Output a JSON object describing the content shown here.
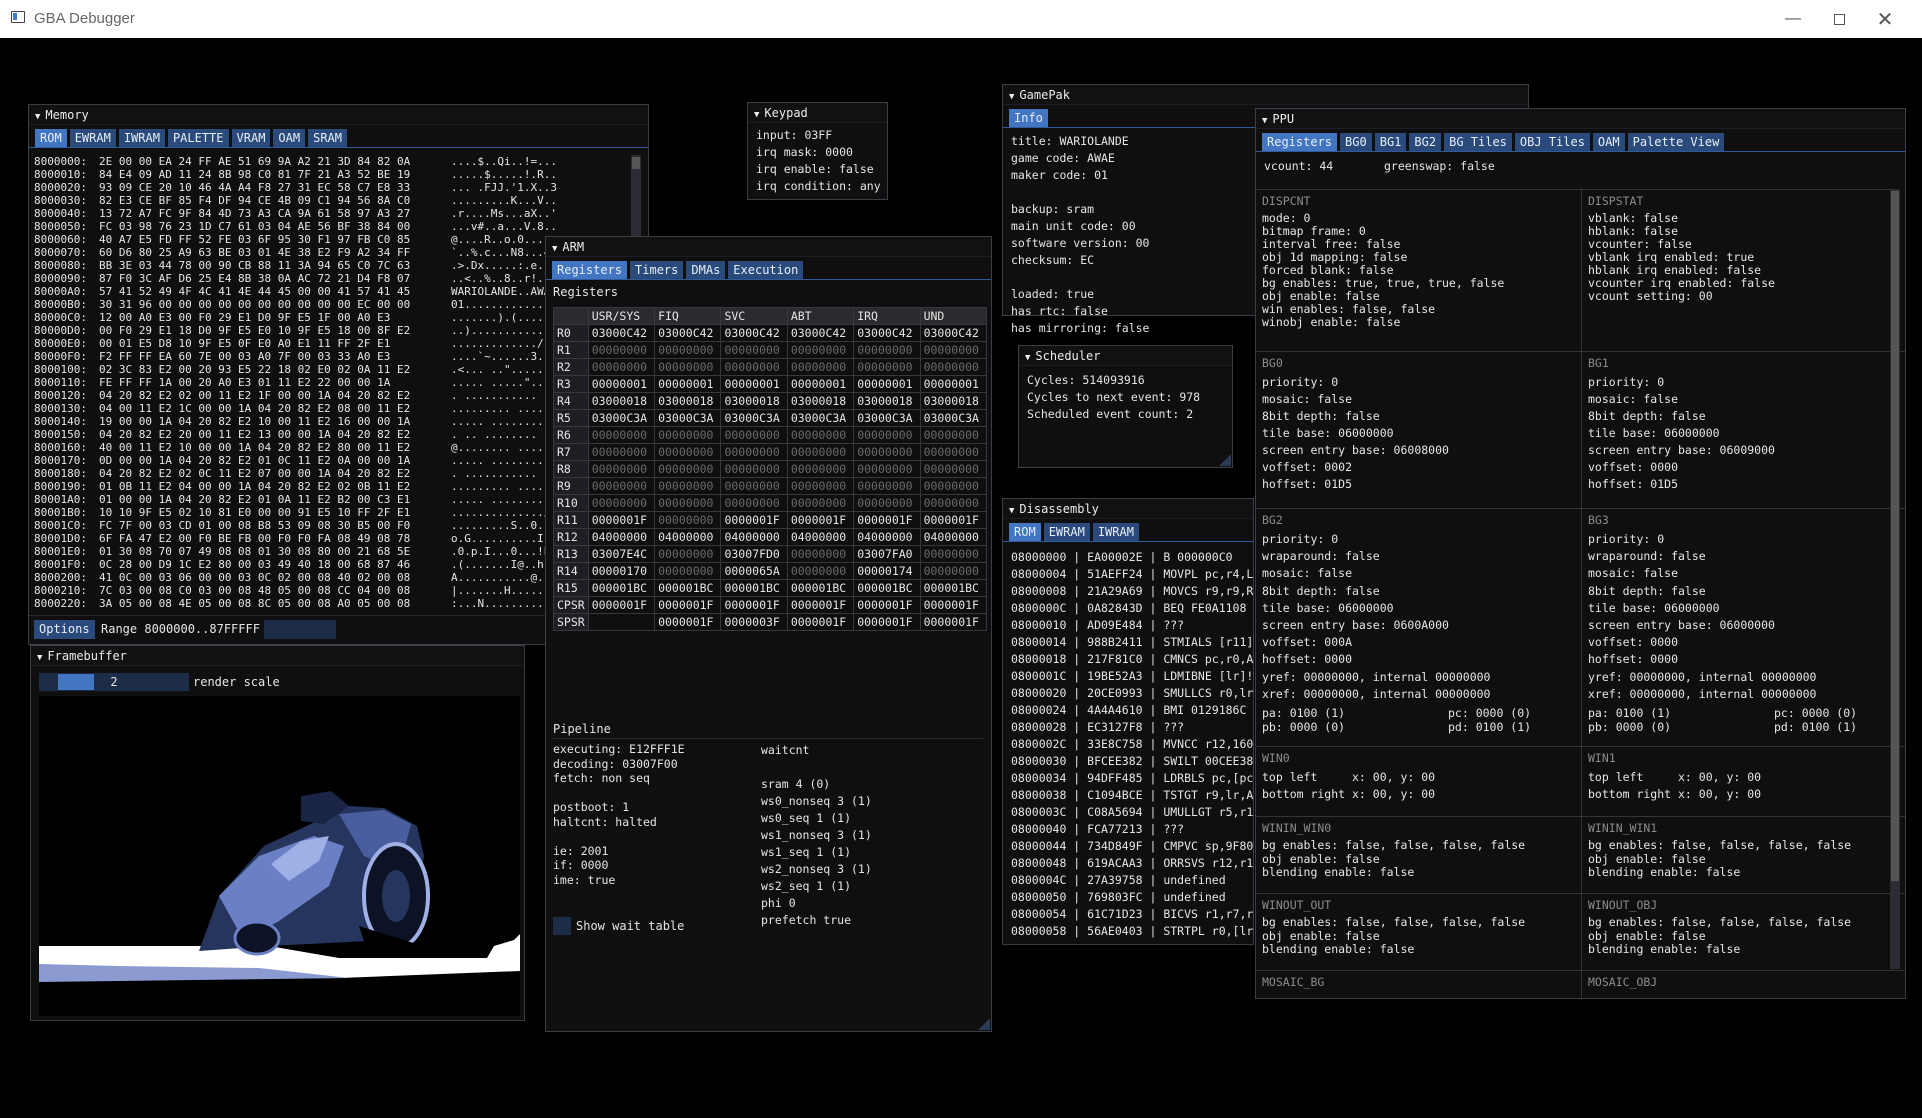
{
  "window": {
    "title": "GBA Debugger"
  },
  "memory": {
    "title": "Memory",
    "tabs": [
      "ROM",
      "EWRAM",
      "IWRAM",
      "PALETTE",
      "VRAM",
      "OAM",
      "SRAM"
    ],
    "rows": [
      {
        "addr": "8000000:",
        "hex": "2E 00 00 EA 24 FF AE 51 69 9A A2 21 3D 84 82 0A",
        "ascii": "....$..Qi..!=..."
      },
      {
        "addr": "8000010:",
        "hex": "84 E4 09 AD 11 24 8B 98 C0 81 7F 21 A3 52 BE 19",
        "ascii": ".....$.....!.R.."
      },
      {
        "addr": "8000020:",
        "hex": "93 09 CE 20 10 46 4A A4 F8 27 31 EC 58 C7 E8 33",
        "ascii": "... .FJJ.'1.X..3"
      },
      {
        "addr": "8000030:",
        "hex": "82 E3 CE BF 85 F4 DF 94 CE 4B 09 C1 94 56 8A C0",
        "ascii": ".........K...V.."
      },
      {
        "addr": "8000040:",
        "hex": "13 72 A7 FC 9F 84 4D 73 A3 CA 9A 61 58 97 A3 27",
        "ascii": ".r....Ms...aX..'"
      },
      {
        "addr": "8000050:",
        "hex": "FC 03 98 76 23 1D C7 61 03 04 AE 56 BF 38 84 00",
        "ascii": "...v#..a...V.8.."
      },
      {
        "addr": "8000060:",
        "hex": "40 A7 E5 FD FF 52 FE 03 6F 95 30 F1 97 FB C0 85",
        "ascii": "@....R..o.0....."
      },
      {
        "addr": "8000070:",
        "hex": "60 D6 80 25 A9 63 BE 03 01 4E 38 E2 F9 A2 34 FF",
        "ascii": "`..%.c...N8...4."
      },
      {
        "addr": "8000080:",
        "hex": "BB 3E 03 44 78 00 90 CB 88 11 3A 94 65 C0 7C 63",
        "ascii": ".>.Dx.....:.e.|c"
      },
      {
        "addr": "8000090:",
        "hex": "87 F0 3C AF D6 25 E4 8B 38 0A AC 72 21 D4 F8 07",
        "ascii": "..<..%..8..r!..."
      },
      {
        "addr": "80000A0:",
        "hex": "57 41 52 49 4F 4C 41 4E 44 45 00 00 41 57 41 45",
        "ascii": "WARIOLANDE..AWAE"
      },
      {
        "addr": "80000B0:",
        "hex": "30 31 96 00 00 00 00 00 00 00 00 00 00 EC 00 00",
        "ascii": "01.............."
      },
      {
        "addr": "80000C0:",
        "hex": "12 00 A0 E3 00 F0 29 E1 D0 9F E5 1F 00 A0 E3",
        "ascii": ".......).(......"
      },
      {
        "addr": "80000D0:",
        "hex": "00 F0 29 E1 18 D0 9F E5 E0 10 9F E5 18 00 8F E2",
        "ascii": "..)............."
      },
      {
        "addr": "80000E0:",
        "hex": "00 01 E5 D8 10 9F E5 0F E0 A0 E1 11 FF 2F E1",
        "ascii": "............./.."
      },
      {
        "addr": "80000F0:",
        "hex": "F2 FF FF EA 60 7E 00 03 A0 7F 00 03 33 A0 E3",
        "ascii": "....`~......3..."
      },
      {
        "addr": "8000100:",
        "hex": "02 3C 83 E2 00 20 93 E5 22 18 02 E0 02 0A 11 E2",
        "ascii": ".<... ..\"......."
      },
      {
        "addr": "8000110:",
        "hex": "FE FF FF 1A 00 20 A0 E3 01 11 E2 22 00 00 1A",
        "ascii": "..... .....\"...."
      },
      {
        "addr": "8000120:",
        "hex": "04 20 82 E2 02 00 11 E2 1F 00 00 1A 04 20 82 E2",
        "ascii": ". ........... .."
      },
      {
        "addr": "8000130:",
        "hex": "04 00 11 E2 1C 00 00 1A 04 20 82 E2 08 00 11 E2",
        "ascii": "......... ......"
      },
      {
        "addr": "8000140:",
        "hex": "19 00 00 1A 04 20 82 E2 10 00 11 E2 16 00 00 1A",
        "ascii": "..... .........."
      },
      {
        "addr": "8000150:",
        "hex": "04 20 82 E2 20 00 11 E2 13 00 00 1A 04 20 82 E2",
        "ascii": ". .. ........ .."
      },
      {
        "addr": "8000160:",
        "hex": "40 00 11 E2 10 00 00 1A 04 20 82 E2 80 00 11 E2",
        "ascii": "@........ ......"
      },
      {
        "addr": "8000170:",
        "hex": "0D 00 00 1A 04 20 82 E2 01 0C 11 E2 0A 00 00 1A",
        "ascii": "..... .........."
      },
      {
        "addr": "8000180:",
        "hex": "04 20 82 E2 02 0C 11 E2 07 00 00 1A 04 20 82 E2",
        "ascii": ". ........... .."
      },
      {
        "addr": "8000190:",
        "hex": "01 0B 11 E2 04 00 00 1A 04 20 82 E2 02 0B 11 E2",
        "ascii": "......... ......"
      },
      {
        "addr": "80001A0:",
        "hex": "01 00 00 1A 04 20 82 E2 01 0A 11 E2 B2 00 C3 E1",
        "ascii": "..... .........."
      },
      {
        "addr": "80001B0:",
        "hex": "10 10 9F E5 02 10 81 E0 00 00 91 E5 10 FF 2F E1",
        "ascii": "............../."
      },
      {
        "addr": "80001C0:",
        "hex": "FC 7F 00 03 CD 01 00 08 B8 53 09 08 30 B5 00 F0",
        "ascii": ".........S..0..."
      },
      {
        "addr": "80001D0:",
        "hex": "6F FA 47 E2 00 F0 BE FB 00 F0 F0 FA 08 49 08 78",
        "ascii": "o.G..........I.x"
      },
      {
        "addr": "80001E0:",
        "hex": "01 30 08 70 07 49 08 08 01 30 08 80 00 21 68 5E",
        "ascii": ".0.p.I...0...!h^"
      },
      {
        "addr": "80001F0:",
        "hex": "0C 28 00 D9 1C E2 80 00 03 49 40 18 00 68 87 46",
        "ascii": ".(.......I@..h.F"
      },
      {
        "addr": "8000200:",
        "hex": "41 0C 00 03 06 00 00 03 0C 02 00 08 40 02 00 08",
        "ascii": "A...........@..."
      },
      {
        "addr": "8000210:",
        "hex": "7C 03 00 08 C0 03 00 08 48 05 00 08 CC 04 00 08",
        "ascii": "|.......H......."
      },
      {
        "addr": "8000220:",
        "hex": "3A 05 00 08 4E 05 00 08 8C 05 00 08 A0 05 00 08",
        "ascii": ":...N..........."
      }
    ],
    "options_label": "Options",
    "range_label": "Range 8000000..87FFFFF",
    "range_value": ""
  },
  "keypad": {
    "title": "Keypad",
    "lines": [
      "input: 03FF",
      "irq mask: 0000",
      "irq enable: false",
      "irq condition: any"
    ]
  },
  "framebuffer": {
    "title": "Framebuffer",
    "scale_value": "2",
    "scale_label": "render scale",
    "scale_fraction": 0.5
  },
  "arm": {
    "title": "ARM",
    "tabs": [
      "Registers",
      "Timers",
      "DMAs",
      "Execution"
    ],
    "section_label": "Registers",
    "columns": [
      "",
      "USR/SYS",
      "FIQ",
      "SVC",
      "ABT",
      "IRQ",
      "UND"
    ],
    "rows": [
      {
        "name": "R0",
        "vals": [
          "03000C42",
          "03000C42",
          "03000C42",
          "03000C42",
          "03000C42",
          "03000C42"
        ]
      },
      {
        "name": "R1",
        "vals": [
          "00000000",
          "00000000",
          "00000000",
          "00000000",
          "00000000",
          "00000000"
        ]
      },
      {
        "name": "R2",
        "vals": [
          "00000000",
          "00000000",
          "00000000",
          "00000000",
          "00000000",
          "00000000"
        ]
      },
      {
        "name": "R3",
        "vals": [
          "00000001",
          "00000001",
          "00000001",
          "00000001",
          "00000001",
          "00000001"
        ]
      },
      {
        "name": "R4",
        "vals": [
          "03000018",
          "03000018",
          "03000018",
          "03000018",
          "03000018",
          "03000018"
        ]
      },
      {
        "name": "R5",
        "vals": [
          "03000C3A",
          "03000C3A",
          "03000C3A",
          "03000C3A",
          "03000C3A",
          "03000C3A"
        ]
      },
      {
        "name": "R6",
        "vals": [
          "00000000",
          "00000000",
          "00000000",
          "00000000",
          "00000000",
          "00000000"
        ]
      },
      {
        "name": "R7",
        "vals": [
          "00000000",
          "00000000",
          "00000000",
          "00000000",
          "00000000",
          "00000000"
        ]
      },
      {
        "name": "R8",
        "vals": [
          "00000000",
          "00000000",
          "00000000",
          "00000000",
          "00000000",
          "00000000"
        ]
      },
      {
        "name": "R9",
        "vals": [
          "00000000",
          "00000000",
          "00000000",
          "00000000",
          "00000000",
          "00000000"
        ]
      },
      {
        "name": "R10",
        "vals": [
          "00000000",
          "00000000",
          "00000000",
          "00000000",
          "00000000",
          "00000000"
        ]
      },
      {
        "name": "R11",
        "vals": [
          "0000001F",
          "00000000",
          "0000001F",
          "0000001F",
          "0000001F",
          "0000001F"
        ]
      },
      {
        "name": "R12",
        "vals": [
          "04000000",
          "04000000",
          "04000000",
          "04000000",
          "04000000",
          "04000000"
        ]
      },
      {
        "name": "R13",
        "vals": [
          "03007E4C",
          "00000000",
          "03007FD0",
          "00000000",
          "03007FA0",
          "00000000"
        ]
      },
      {
        "name": "R14",
        "vals": [
          "00000170",
          "00000000",
          "0000065A",
          "00000000",
          "00000174",
          "00000000"
        ]
      },
      {
        "name": "R15",
        "vals": [
          "000001BC",
          "000001BC",
          "000001BC",
          "000001BC",
          "000001BC",
          "000001BC"
        ]
      },
      {
        "name": "CPSR",
        "vals": [
          "0000001F",
          "0000001F",
          "0000001F",
          "0000001F",
          "0000001F",
          "0000001F"
        ]
      },
      {
        "name": "SPSR",
        "vals": [
          "",
          "0000001F",
          "0000003F",
          "0000001F",
          "0000001F",
          "0000001F"
        ]
      }
    ],
    "pipeline_label": "Pipeline",
    "pipeline_left": [
      "executing: E12FFF1E",
      "decoding: 03007F00",
      "fetch: non seq",
      "",
      "postboot: 1",
      "haltcnt: halted",
      "",
      "ie: 2001",
      "if: 0000",
      "ime: true"
    ],
    "waitcnt": [
      "waitcnt",
      "",
      "sram 4 (0)",
      "ws0_nonseq 3 (1)",
      "ws0_seq 1 (1)",
      "ws1_nonseq 3 (1)",
      "ws1_seq 1 (1)",
      "ws2_nonseq 3 (1)",
      "ws2_seq 1 (1)",
      "phi 0",
      "prefetch true"
    ],
    "show_wait_table": "Show wait table"
  },
  "gamepak": {
    "title": "GamePak",
    "tab": "Info",
    "lines": [
      "title: WARIOLANDE",
      "game code: AWAE",
      "maker code: 01",
      "",
      "backup: sram",
      "main unit code: 00",
      "software version: 00",
      "checksum: EC",
      "",
      "loaded: true",
      "has rtc: false",
      "has mirroring: false"
    ]
  },
  "scheduler": {
    "title": "Scheduler",
    "lines": [
      "Cycles: 514093916",
      "Cycles to next event: 978",
      "Scheduled event count: 2"
    ]
  },
  "disassembly": {
    "title": "Disassembly",
    "tabs": [
      "ROM",
      "EWRAM",
      "IWRAM"
    ],
    "lines": [
      "08000000 | EA00002E | B 000000C0",
      "08000004 | 51AEFF24 | MOVPL pc,r4,L",
      "08000008 | 21A29A69 | MOVCS r9,r9,R",
      "0800000C | 0A82843D | BEQ FE0A1108",
      "08000010 | AD09E484 | ???",
      "08000014 | 988B2411 | STMIALS [r11]",
      "08000018 | 217F81C0 | CMNCS pc,r0,A",
      "0800001C | 19BE52A3 | LDMIBNE [lr]!",
      "08000020 | 20CE0993 | SMULLCS r0,lr",
      "08000024 | 4A4A4610 | BMI 0129186C",
      "08000028 | EC3127F8 | ???",
      "0800002C | 33E8C758 | MVNCC r12,160",
      "08000030 | BFCEE382 | SWILT 00CEE38",
      "08000034 | 94DFF485 | LDRBLS pc,[pc",
      "08000038 | C1094BCE | TSTGT r9,lr,A",
      "0800003C | C08A5694 | UMULLGT r5,r1",
      "08000040 | FCA77213 | ???",
      "08000044 | 734D849F | CMPVC sp,9F80",
      "08000048 | 619ACAA3 | ORRSVS r12,r1",
      "0800004C | 27A39758 | undefined",
      "08000050 | 769803FC | undefined",
      "08000054 | 61C71D23 | BICVS r1,r7,r",
      "08000058 | 56AE0403 | STRTPL r0,[lr"
    ]
  },
  "ppu": {
    "title": "PPU",
    "tabs": [
      "Registers",
      "BG0",
      "BG1",
      "BG2",
      "BG Tiles",
      "OBJ Tiles",
      "OAM",
      "Palette View"
    ],
    "vcount": "vcount: 44",
    "greenswap": "greenswap: false",
    "dispcnt": {
      "head": "DISPCNT",
      "lines": [
        "mode: 0",
        "bitmap frame: 0",
        "interval free: false",
        "obj 1d mapping: false",
        "forced blank: false",
        "bg enables: true, true, true, false",
        "obj enable: false",
        "win enables: false, false",
        "winobj enable: false"
      ]
    },
    "dispstat": {
      "head": "DISPSTAT",
      "lines": [
        "vblank: false",
        "hblank: false",
        "vcounter: false",
        "vblank irq enabled: true",
        "hblank irq enabled: false",
        "vcounter irq enabled: false",
        "vcount setting: 00"
      ]
    },
    "bg0": {
      "head": "BG0",
      "lines": [
        "priority: 0",
        "mosaic: false",
        "8bit depth: false",
        "tile base: 06000000",
        "screen entry base: 06008000",
        "voffset: 0002",
        "hoffset: 01D5"
      ]
    },
    "bg1": {
      "head": "BG1",
      "lines": [
        "priority: 0",
        "mosaic: false",
        "8bit depth: false",
        "tile base: 06000000",
        "screen entry base: 06009000",
        "voffset: 0000",
        "hoffset: 01D5"
      ]
    },
    "bg2": {
      "head": "BG2",
      "lines": [
        "priority: 0",
        "wraparound: false",
        "mosaic: false",
        "8bit depth: false",
        "tile base: 06000000",
        "screen entry base: 0600A000",
        "voffset: 000A",
        "hoffset: 0000",
        "yref: 00000000, internal 00000000",
        "xref: 00000000, internal 00000000"
      ],
      "pa": "pa: 0100 (1)",
      "pb": "pb: 0000 (0)",
      "pc": "pc: 0000 (0)",
      "pd": "pd: 0100 (1)"
    },
    "bg3": {
      "head": "BG3",
      "lines": [
        "priority: 0",
        "wraparound: false",
        "mosaic: false",
        "8bit depth: false",
        "tile base: 06000000",
        "screen entry base: 06000000",
        "voffset: 0000",
        "hoffset: 0000",
        "yref: 00000000, internal 00000000",
        "xref: 00000000, internal 00000000"
      ],
      "pa": "pa: 0100 (1)",
      "pb": "pb: 0000 (0)",
      "pc": "pc: 0000 (0)",
      "pd": "pd: 0100 (1)"
    },
    "win0": {
      "head": "WIN0",
      "lines": [
        "top left     x: 00, y: 00",
        "bottom right x: 00, y: 00"
      ]
    },
    "win1": {
      "head": "WIN1",
      "lines": [
        "top left     x: 00, y: 00",
        "bottom right x: 00, y: 00"
      ]
    },
    "winin0": {
      "head": "WININ_WIN0",
      "lines": [
        "bg enables: false, false, false, false",
        "obj enable: false",
        "blending enable: false"
      ]
    },
    "winin1": {
      "head": "WININ_WIN1",
      "lines": [
        "bg enables: false, false, false, false",
        "obj enable: false",
        "blending enable: false"
      ]
    },
    "winout": {
      "head": "WINOUT_OUT",
      "lines": [
        "bg enables: false, false, false, false",
        "obj enable: false",
        "blending enable: false"
      ]
    },
    "winobj": {
      "head": "WINOUT_OBJ",
      "lines": [
        "bg enables: false, false, false, false",
        "obj enable: false",
        "blending enable: false"
      ]
    },
    "mosaic_bg": "MOSAIC_BG",
    "mosaic_obj": "MOSAIC_OBJ"
  },
  "icons": {
    "window": "app-window-icon",
    "collapse": "collapse-triangle-icon"
  },
  "colors": {
    "tab_active": "#4276c2",
    "tab": "#294a7a",
    "window_bg": "#0f0f0f",
    "screen_blue": "#6b7fc4"
  }
}
